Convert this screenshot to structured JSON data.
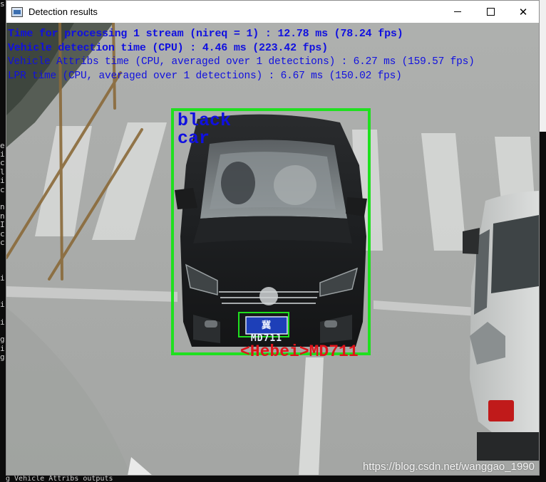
{
  "window": {
    "title": "Detection results",
    "app_icon": "window-app-icon",
    "buttons": {
      "minimize": "minimize-icon",
      "maximize": "maximize-icon",
      "close": "close-icon"
    }
  },
  "stats": {
    "line1": "Time for processing 1 stream (nireq = 1) : 12.78 ms (78.24 fps)",
    "line2": "Vehicle detection time (CPU) : 4.46 ms (223.42 fps)",
    "line3": "Vehicle Attribs time (CPU, averaged over 1 detections) : 6.27 ms (159.57 fps)",
    "line4": "LPR time (CPU, averaged over 1 detections) : 6.67 ms (150.02 fps)"
  },
  "detection": {
    "vehicle_color": "black",
    "vehicle_type": "car",
    "plate_text": "冀 MD711",
    "plate_label": "<Hebei>MD711",
    "box_color": "#1fe01f",
    "attr_color": "#1010e0",
    "plate_label_color": "#e0141a"
  },
  "watermark": "https://blog.csdn.net/wanggao_1990",
  "console": {
    "left_chars": [
      "s",
      "",
      "",
      "",
      "",
      "",
      "",
      "",
      "",
      "",
      "",
      "",
      "",
      "",
      "",
      "",
      "e",
      "i",
      "c",
      "l",
      "i",
      "c",
      "",
      "n",
      "n",
      "I",
      "c",
      "c",
      "",
      "",
      "",
      "i",
      "",
      "",
      "i",
      "",
      "i",
      "",
      "g",
      "i",
      "g",
      "",
      "",
      "",
      "",
      "",
      "",
      ""
    ],
    "bottom_text": "g Vehicle Attribs outputs"
  }
}
